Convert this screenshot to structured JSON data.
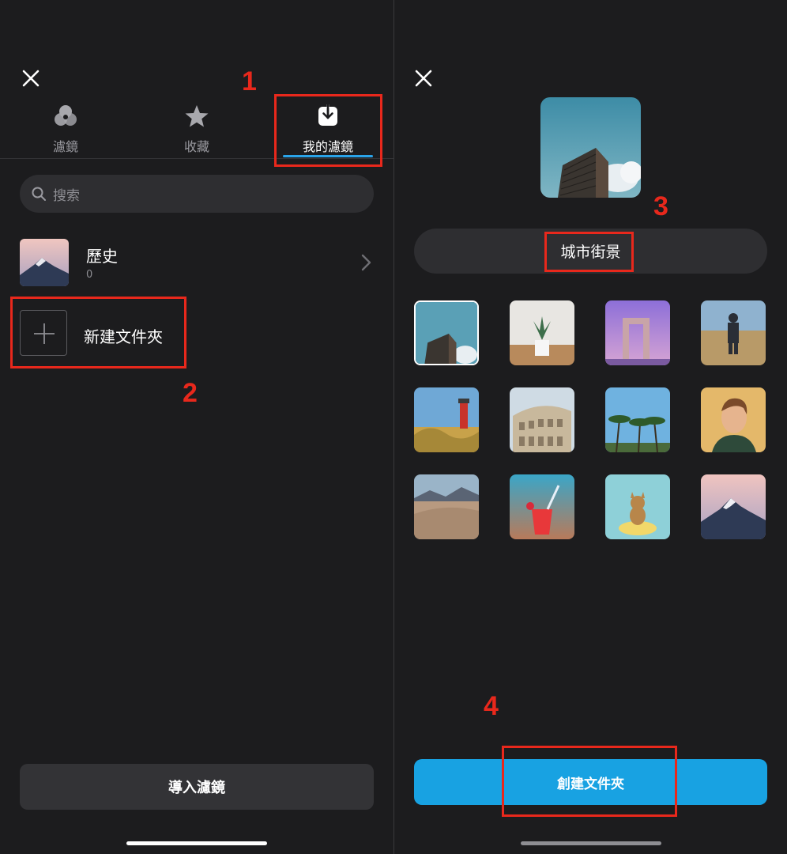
{
  "left": {
    "tabs": [
      {
        "label": "濾鏡",
        "icon": "filters-icon"
      },
      {
        "label": "收藏",
        "icon": "star-icon"
      },
      {
        "label": "我的濾鏡",
        "icon": "download-box-icon"
      }
    ],
    "search_placeholder": "搜索",
    "history": {
      "title": "歷史",
      "count": "0"
    },
    "new_folder_label": "新建文件夾",
    "import_label": "導入濾鏡"
  },
  "right": {
    "folder_name": "城市街景",
    "thumbnails": [
      "city-building",
      "plant-pot",
      "purple-arch",
      "man-in-field",
      "lighthouse",
      "colosseum",
      "palm-trees",
      "woman-portrait",
      "desert-dunes",
      "red-drink",
      "dog-on-float",
      "snowy-mountain"
    ],
    "create_label": "創建文件夾"
  },
  "annotations": [
    "1",
    "2",
    "3",
    "4"
  ],
  "colors": {
    "background": "#1c1c1e",
    "accent": "#18a2e2",
    "annotation": "#e8281c"
  }
}
